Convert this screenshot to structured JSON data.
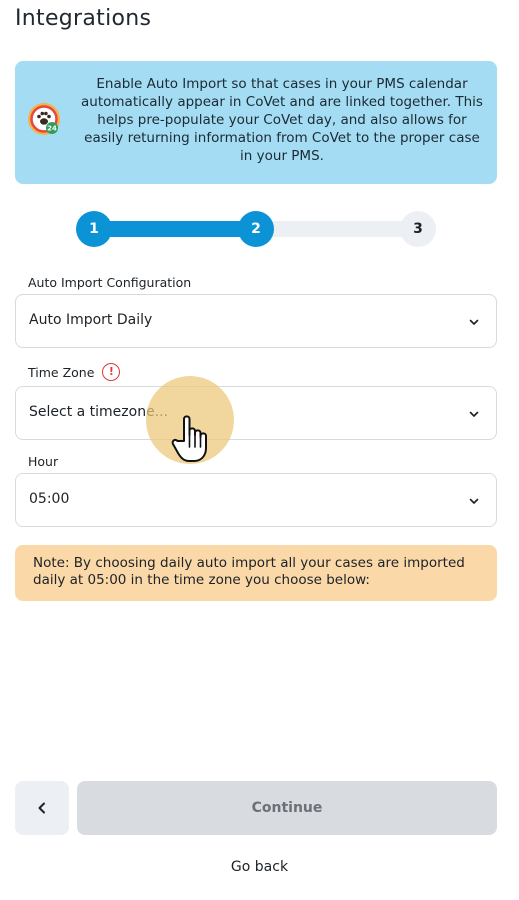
{
  "page": {
    "title": "Integrations"
  },
  "info_banner": {
    "text": "Enable Auto Import so that cases in your PMS calendar automatically appear in CoVet and are linked together. This helps pre-populate your CoVet day, and also allows for easily returning information from CoVet to the proper case in your PMS.",
    "icon": "covet-paw-24-icon",
    "background": "#a4dcf3",
    "icon_badge": "24"
  },
  "stepper": {
    "steps": [
      {
        "label": "1",
        "state": "done"
      },
      {
        "label": "2",
        "state": "current"
      },
      {
        "label": "3",
        "state": "upcoming"
      }
    ],
    "accent_color": "#0c93d6"
  },
  "fields": {
    "auto_import": {
      "label": "Auto Import Configuration",
      "value": "Auto Import Daily"
    },
    "time_zone": {
      "label": "Time Zone",
      "placeholder": "Select a timezone...",
      "warning_icon": "!"
    },
    "hour": {
      "label": "Hour",
      "value": "05:00"
    }
  },
  "note": {
    "text": "Note: By choosing daily auto import all your cases are imported daily at 05:00 in the time zone you choose below:",
    "background": "#fbd8a8"
  },
  "footer": {
    "back_icon": "chevron-left-icon",
    "continue_label": "Continue",
    "go_back_label": "Go back"
  }
}
